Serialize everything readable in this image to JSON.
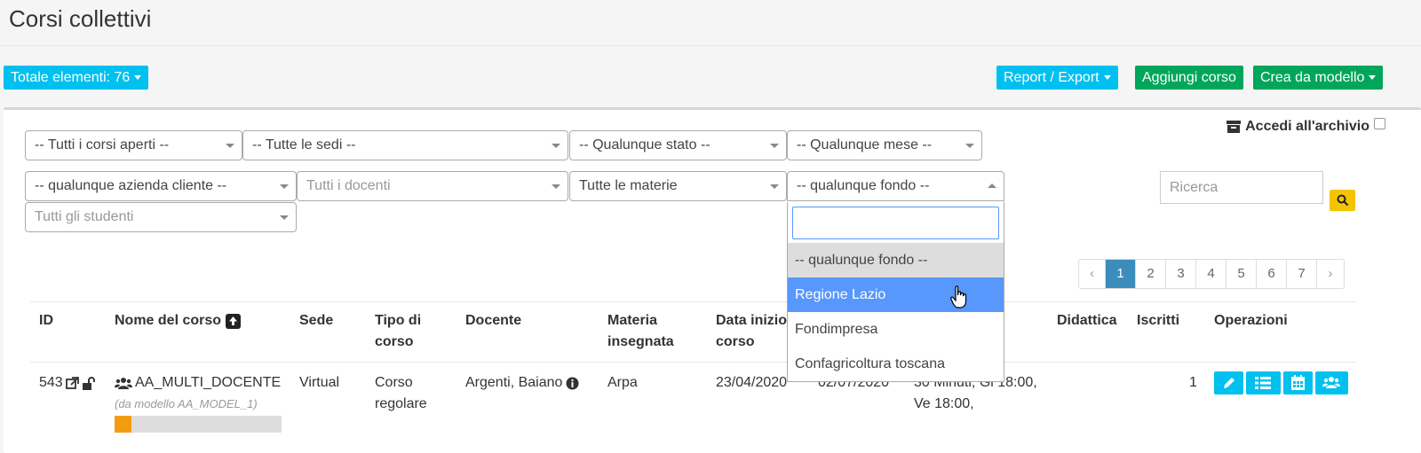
{
  "header": {
    "title": "Corsi collettivi"
  },
  "toolbar": {
    "total_label": "Totale elementi: 76",
    "report_label": "Report / Export",
    "add_label": "Aggiungi corso",
    "template_label": "Crea da modello"
  },
  "archive": {
    "label": "Accedi all'archivio"
  },
  "filters": {
    "courses": "-- Tutti i corsi aperti --",
    "sites": "-- Tutte le sedi --",
    "state": "-- Qualunque stato --",
    "month": "-- Qualunque mese --",
    "company": "-- qualunque azienda cliente --",
    "teachers": "Tutti i docenti",
    "subjects": "Tutte le materie",
    "fund": "-- qualunque fondo --",
    "students": "Tutti gli studenti"
  },
  "fund_dropdown": {
    "options": [
      "-- qualunque fondo --",
      "Regione Lazio",
      "Fondimpresa",
      "Confagricoltura toscana"
    ],
    "highlighted": "Regione Lazio"
  },
  "search": {
    "placeholder": "Ricerca"
  },
  "pagination": {
    "prev": "‹",
    "pages": [
      "1",
      "2",
      "3",
      "4",
      "5",
      "6",
      "7"
    ],
    "current": "1",
    "next": "›"
  },
  "table": {
    "headers": {
      "id": "ID",
      "name": "Nome del corso",
      "site": "Sede",
      "type_1": "Tipo di",
      "type_2": "corso",
      "teacher": "Docente",
      "subject_1": "Materia",
      "subject_2": "insegnata",
      "start_1": "Data inizio",
      "start_2": "corso",
      "didactics": "Didattica",
      "enrolled": "Iscritti",
      "operations": "Operazioni"
    },
    "rows": [
      {
        "id": "543",
        "name": "AA_MULTI_DOCENTE",
        "template_note": "(da modello AA_MODEL_1)",
        "site": "Virtual",
        "type_1": "Corso",
        "type_2": "regolare",
        "teacher": "Argenti, Baiano",
        "subject": "Arpa",
        "start": "23/04/2020",
        "end": "02/07/2020",
        "schedule_1": "30 Minuti, Gi 18:00,",
        "schedule_2": "Ve 18:00,",
        "enrolled": "1",
        "progress": 0.1
      }
    ]
  },
  "colors": {
    "info": "#00c0ef",
    "success": "#00a65a",
    "active_page": "#3c8dbc",
    "highlight": "#5897fb",
    "progress": "#f39c12",
    "search_button": "#f5c400"
  }
}
